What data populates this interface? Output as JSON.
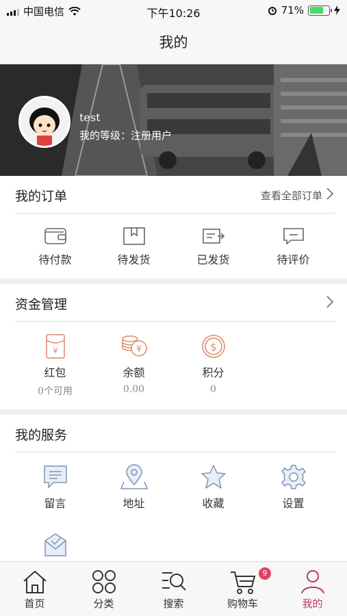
{
  "status": {
    "carrier": "中国电信",
    "time": "下午10:26",
    "battery": "71%"
  },
  "nav": {
    "title": "我的"
  },
  "profile": {
    "username": "test",
    "level_label": "我的等级：",
    "level_value": "注册用户"
  },
  "orders": {
    "title": "我的订单",
    "view_all": "查看全部订单",
    "items": [
      {
        "label": "待付款",
        "icon": "wallet-icon"
      },
      {
        "label": "待发货",
        "icon": "box-icon"
      },
      {
        "label": "已发货",
        "icon": "truck-icon"
      },
      {
        "label": "待评价",
        "icon": "comment-icon"
      }
    ]
  },
  "funds": {
    "title": "资金管理",
    "items": [
      {
        "label": "红包",
        "sub": "0个可用",
        "icon": "red-packet-icon"
      },
      {
        "label": "余额",
        "sub": "0.00",
        "icon": "coins-icon"
      },
      {
        "label": "积分",
        "sub": "0",
        "icon": "points-icon"
      }
    ]
  },
  "services": {
    "title": "我的服务",
    "items": [
      {
        "label": "留言",
        "icon": "message-icon"
      },
      {
        "label": "地址",
        "icon": "location-icon"
      },
      {
        "label": "收藏",
        "icon": "star-icon"
      },
      {
        "label": "设置",
        "icon": "gear-icon"
      },
      {
        "label": "",
        "icon": "mail-check-icon"
      }
    ]
  },
  "tabbar": {
    "items": [
      {
        "label": "首页",
        "icon": "home-icon"
      },
      {
        "label": "分类",
        "icon": "category-icon"
      },
      {
        "label": "搜索",
        "icon": "search-icon"
      },
      {
        "label": "购物车",
        "icon": "cart-icon",
        "badge": "9"
      },
      {
        "label": "我的",
        "icon": "user-icon",
        "active": true
      }
    ]
  },
  "colors": {
    "accent": "#c0375a",
    "funds_icon": "#d98a6a",
    "service_icon": "#7d93b8"
  }
}
